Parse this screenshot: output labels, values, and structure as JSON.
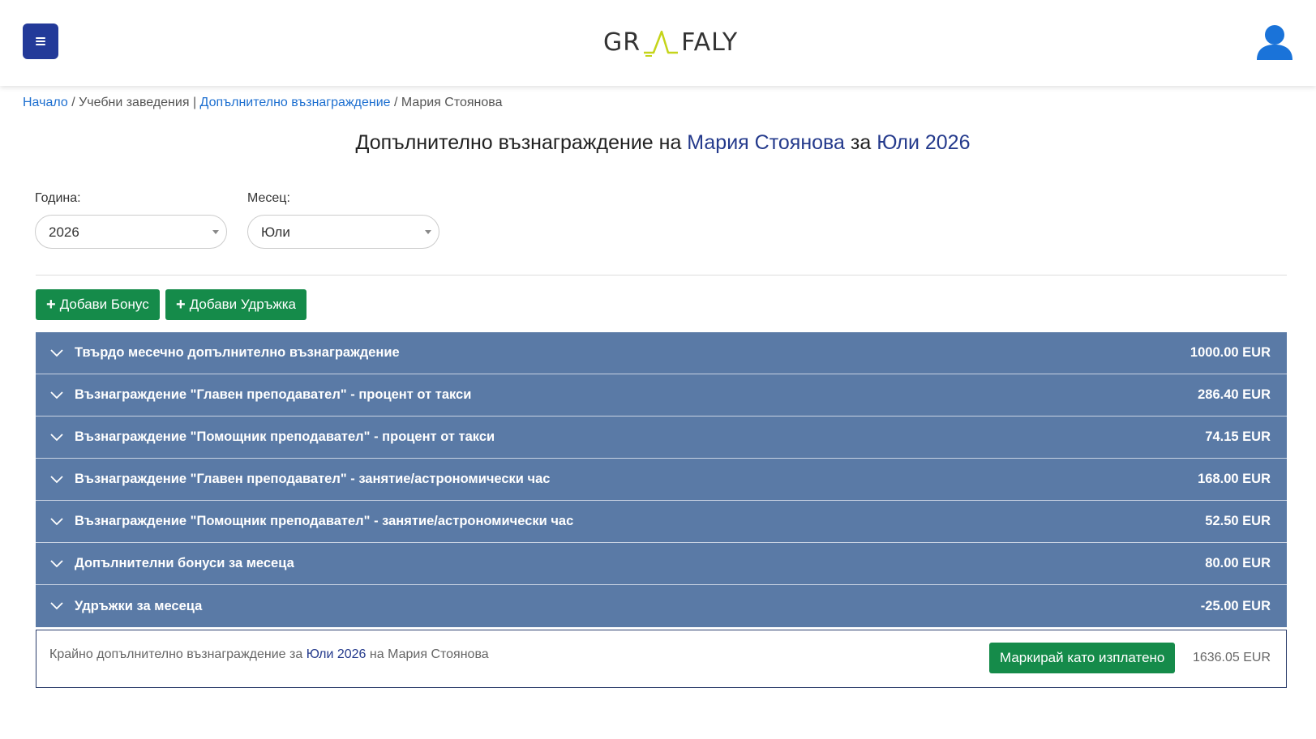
{
  "header": {
    "logo_left": "GR",
    "logo_right": "FALY",
    "colors": {
      "menu_button": "#233a99",
      "user_icon": "#1a73d9",
      "logo_accent": "#c5d41a"
    }
  },
  "breadcrumb": {
    "home": "Начало",
    "sep1": "/",
    "schools": "Учебни заведения",
    "sep2": "|",
    "bonus": "Допълнително възнаграждение",
    "sep3": "/",
    "person": "Мария Стоянова"
  },
  "title": {
    "prefix": "Допълнително възнаграждение на",
    "person": "Мария Стоянова",
    "middle": "за",
    "period": "Юли 2026"
  },
  "filters": {
    "year_label": "Година:",
    "year_value": "2026",
    "month_label": "Месец:",
    "month_value": "Юли"
  },
  "actions": {
    "add_bonus": "Добави Бонус",
    "add_deduction": "Добави Удръжка"
  },
  "rows": [
    {
      "title": "Твърдо месечно допълнително възнаграждение",
      "amount": "1000.00 EUR"
    },
    {
      "title": "Възнаграждение \"Главен преподавател\" - процент от такси",
      "amount": "286.40 EUR"
    },
    {
      "title": "Възнаграждение \"Помощник преподавател\" - процент от такси",
      "amount": "74.15 EUR"
    },
    {
      "title": "Възнаграждение \"Главен преподавател\" - занятие/астрономически час",
      "amount": "168.00 EUR"
    },
    {
      "title": "Възнаграждение \"Помощник преподавател\" - занятие/астрономически час",
      "amount": "52.50 EUR"
    },
    {
      "title": "Допълнителни бонуси за месеца",
      "amount": "80.00 EUR"
    },
    {
      "title": "Удръжки за месеца",
      "amount": "-25.00 EUR"
    }
  ],
  "total": {
    "prefix": "Крайно допълнително възнаграждение за",
    "period": "Юли 2026",
    "middle": "на",
    "person": "Мария Стоянова",
    "mark_paid": "Маркирай като изплатено",
    "amount": "1636.05 EUR"
  }
}
